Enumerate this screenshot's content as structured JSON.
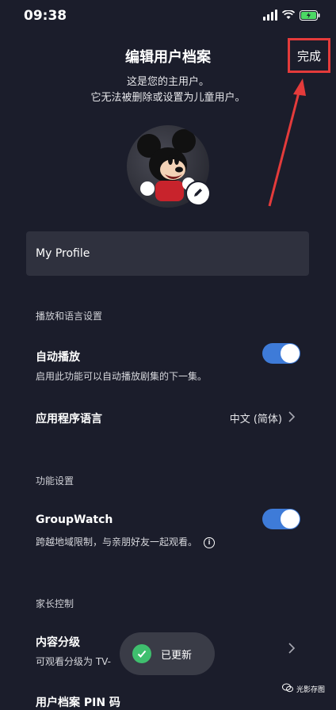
{
  "status_bar": {
    "time": "09:38"
  },
  "header": {
    "title": "编辑用户档案",
    "done_label": "完成"
  },
  "subtitle": {
    "line1": "这是您的主用户。",
    "line2": "它无法被删除或设置为儿童用户。"
  },
  "profile_name": {
    "value": "My Profile"
  },
  "sections": {
    "playback": {
      "header": "播放和语言设置",
      "autoplay_title": "自动播放",
      "autoplay_desc": "启用此功能可以自动播放剧集的下一集。",
      "autoplay_on": true,
      "language_title": "应用程序语言",
      "language_value": "中文 (简体)"
    },
    "features": {
      "header": "功能设置",
      "groupwatch_title": "GroupWatch",
      "groupwatch_desc": "跨越地域限制，与亲朋好友一起观看。",
      "groupwatch_on": true
    },
    "parental": {
      "header": "家长控制",
      "rating_title": "内容分级",
      "rating_desc": "可观看分级为 TV-",
      "pin_title": "用户档案 PIN 码"
    }
  },
  "toast": {
    "text": "已更新",
    "icon": "check-icon"
  },
  "watermark": {
    "text": "光影存图"
  },
  "colors": {
    "background": "#1b1d2b",
    "accent_toggle": "#3e7bd8",
    "highlight_red": "#e43b3b",
    "toast_check": "#3fbf6e"
  }
}
